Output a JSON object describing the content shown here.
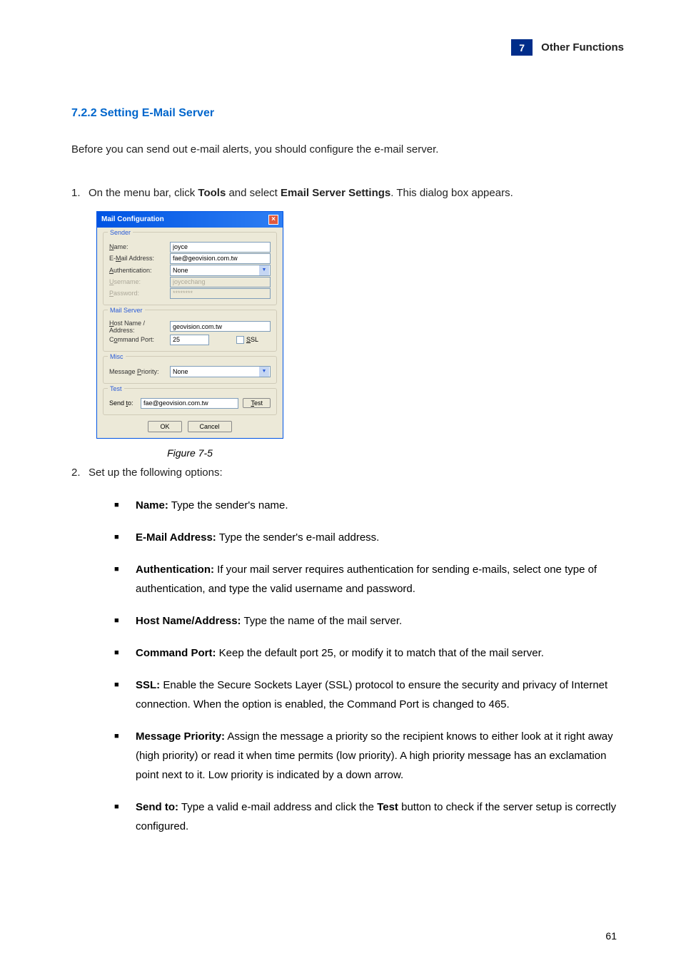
{
  "header": {
    "badge": "7",
    "text": "Other Functions"
  },
  "section_title": "7.2.2  Setting E-Mail Server",
  "intro": "Before you can send out e-mail alerts, you should configure the e-mail server.",
  "step1": {
    "num": "1.",
    "prefix": "On the menu bar, click ",
    "tools": "Tools",
    "mid": " and select ",
    "settings": "Email Server Settings",
    "suffix": ". This dialog box appears."
  },
  "dialog": {
    "title": "Mail Configuration",
    "close": "×",
    "sender": {
      "legend": "Sender",
      "name_label": "Name:",
      "name_value": "joyce",
      "email_label": "E-Mail Address:",
      "email_value": "fae@geovision.com.tw",
      "auth_label": "Authentication:",
      "auth_value": "None",
      "user_label": "Username:",
      "user_value": "joycechang",
      "pass_label": "Password:",
      "pass_value": "********"
    },
    "mailserver": {
      "legend": "Mail Server",
      "host_label": "Host Name / Address:",
      "host_value": "geovision.com.tw",
      "port_label": "Command Port:",
      "port_value": "25",
      "ssl_label": "SSL"
    },
    "misc": {
      "legend": "Misc",
      "priority_label": "Message Priority:",
      "priority_value": "None"
    },
    "test": {
      "legend": "Test",
      "sendto_label": "Send to:",
      "sendto_value": "fae@geovision.com.tw",
      "test_btn": "Test"
    },
    "ok": "OK",
    "cancel": "Cancel"
  },
  "figure_caption": "Figure 7-5",
  "step2": {
    "num": "2.",
    "text": "Set up the following options:"
  },
  "bullets": [
    {
      "bold": "Name:",
      "text": " Type the sender's name."
    },
    {
      "bold": "E-Mail Address:",
      "text": " Type the sender's e-mail address."
    },
    {
      "bold": "Authentication:",
      "text": " If your mail server requires authentication for sending e-mails, select one type of authentication, and type the valid username and password."
    },
    {
      "bold": "Host Name/Address:",
      "text": " Type the name of the mail server."
    },
    {
      "bold": "Command Port:",
      "text": " Keep the default port 25, or modify it to match that of the mail server."
    },
    {
      "bold": "SSL:",
      "text": " Enable the Secure Sockets Layer (SSL) protocol to ensure the security and privacy of Internet connection. When the option is enabled, the Command Port is changed to 465."
    },
    {
      "bold": "Message Priority:",
      "text": " Assign the message a priority so the recipient knows to either look at it right away (high priority) or read it when time permits (low priority). A high priority message has an exclamation point next to it. Low priority is indicated by a down arrow."
    },
    {
      "bold": "Send to:",
      "text": " Type a valid e-mail address and click the ",
      "bold2": "Test",
      "text2": " button to check if the server setup is correctly configured."
    }
  ],
  "page_num": "61"
}
